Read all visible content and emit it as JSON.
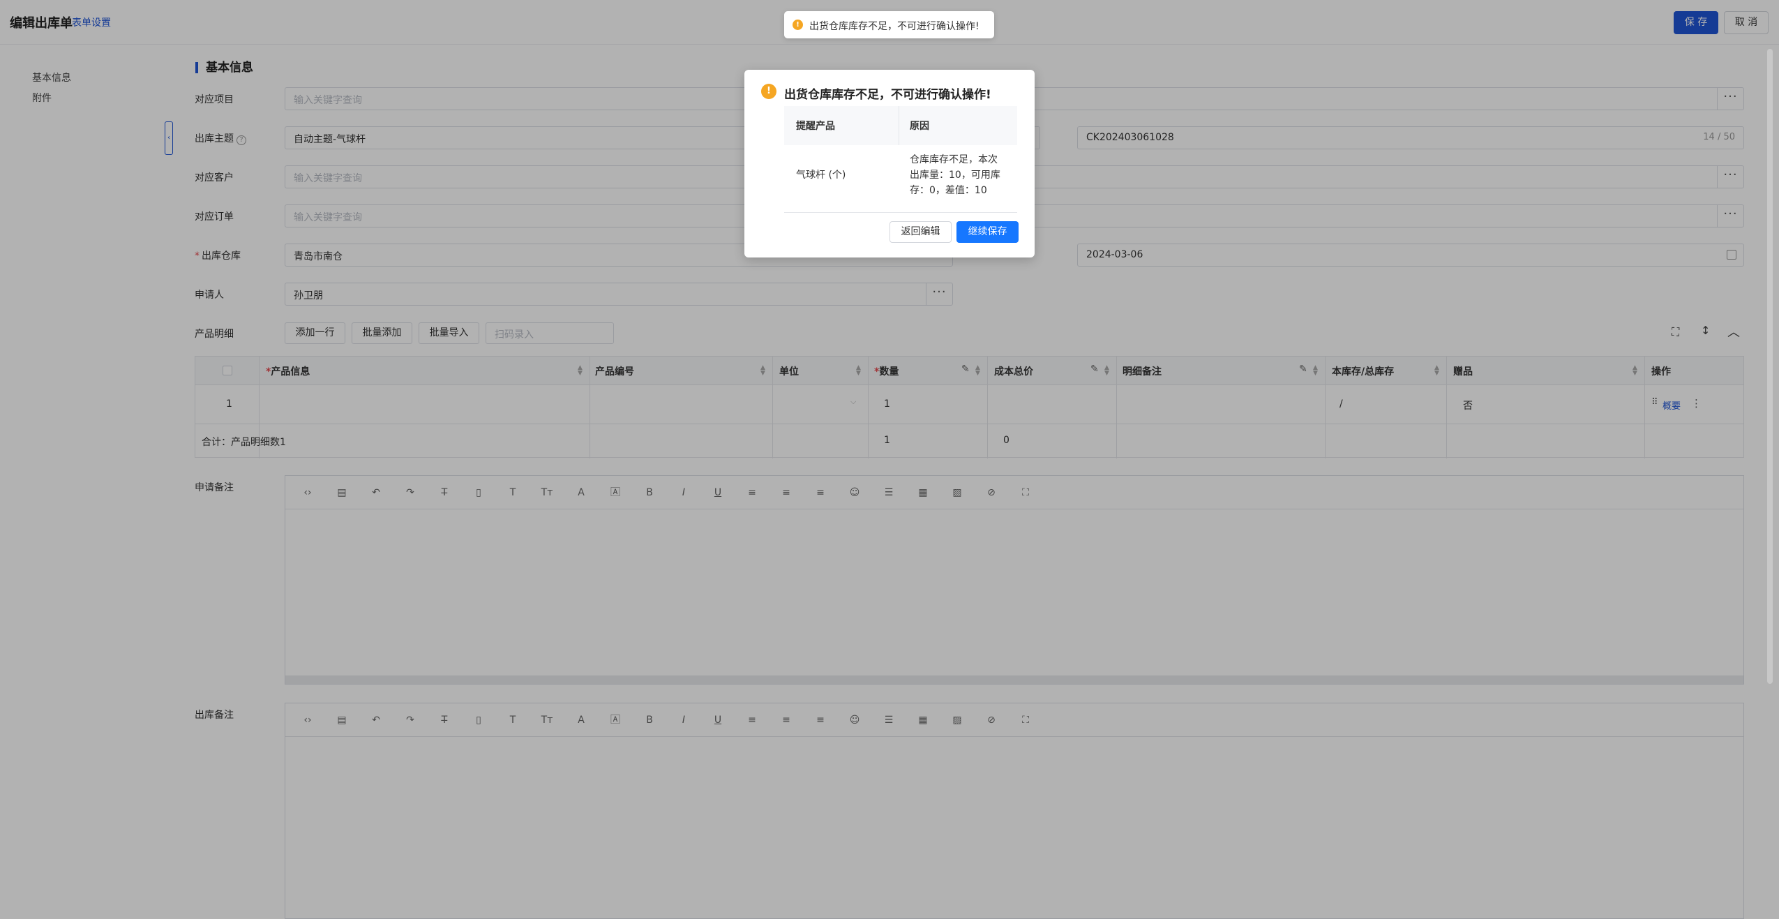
{
  "header": {
    "title": "编辑出库单",
    "form_setting": "表单设置",
    "save_label": "保 存",
    "cancel_label": "取 消"
  },
  "sidebar": {
    "items": [
      {
        "label": "基本信息"
      },
      {
        "label": "附件"
      }
    ]
  },
  "section": {
    "title": "基本信息"
  },
  "form": {
    "project_label": "对应项目",
    "project_placeholder": "输入关键字查询",
    "subject_label": "出库主题",
    "subject_value": "自动主题-气球杆",
    "order_no_value": "CK202403061028",
    "order_no_counter": "14 / 50",
    "customer_label": "对应客户",
    "customer_placeholder": "输入关键字查询",
    "order_label": "对应订单",
    "order_placeholder": "输入关键字查询",
    "warehouse_label": "出库仓库",
    "warehouse_value": "青岛市南仓",
    "date_value": "2024-03-06",
    "applicant_label": "申请人",
    "applicant_value": "孙卫朋",
    "detail_label": "产品明细"
  },
  "toolbar": {
    "add_row": "添加一行",
    "batch_add": "批量添加",
    "batch_import": "批量导入",
    "scan_placeholder": "扫码录入"
  },
  "table": {
    "headers": {
      "product_info": "产品信息",
      "product_code": "产品编号",
      "unit": "单位",
      "quantity": "数量",
      "cost_total": "成本总价",
      "detail_note": "明细备注",
      "stock": "本库存/总库存",
      "gift": "赠品",
      "action": "操作"
    },
    "row": {
      "index": "1",
      "quantity": "1",
      "stock": "/",
      "gift": "否",
      "action_link": "概要"
    },
    "total": {
      "label": "合计：产品明细数1",
      "quantity": "1",
      "cost": "0"
    }
  },
  "editors": {
    "apply_note_label": "申请备注",
    "out_note_label": "出库备注"
  },
  "toast": {
    "message": "出货仓库库存不足，不可进行确认操作!"
  },
  "modal": {
    "title": "出货仓库库存不足，不可进行确认操作!",
    "col_product": "提醒产品",
    "col_reason": "原因",
    "product": "气球杆 (个)",
    "reason_line1": "仓库库存不足，本次",
    "reason_line2": "出库量：10，可用库",
    "reason_line3": "存：0，差值：10",
    "back_label": "返回编辑",
    "continue_label": "继续保存"
  },
  "colors": {
    "primary": "#1f55d6",
    "warning": "#f5a623",
    "modal_button": "#1677ff"
  }
}
